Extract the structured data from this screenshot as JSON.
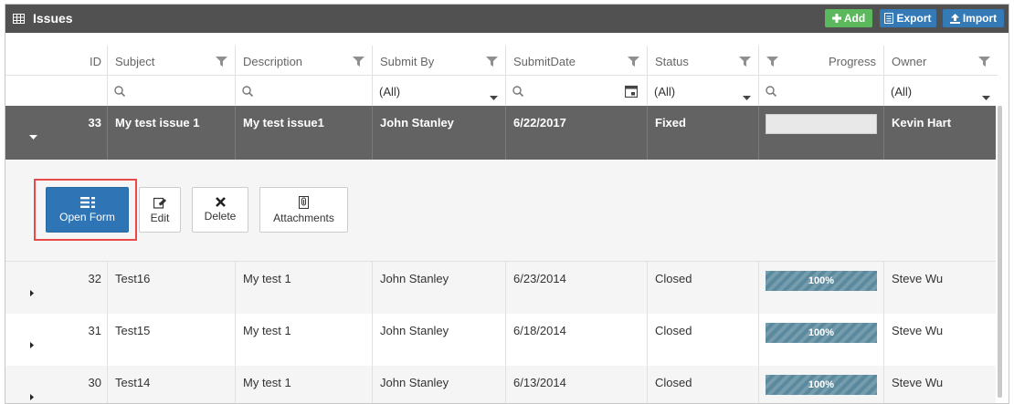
{
  "title": "Issues",
  "toolbar": {
    "add": "Add",
    "export": "Export",
    "import": "Import"
  },
  "columns": {
    "id": "ID",
    "subject": "Subject",
    "description": "Description",
    "submit_by": "Submit By",
    "submit_date": "SubmitDate",
    "status": "Status",
    "progress": "Progress",
    "owner": "Owner"
  },
  "filters": {
    "submit_by": "(All)",
    "status": "(All)",
    "owner": "(All)"
  },
  "selected_row": {
    "id": "33",
    "subject": "My test issue 1",
    "description": "My test issue1",
    "submit_by": "John Stanley",
    "submit_date": "6/22/2017",
    "status": "Fixed",
    "owner": "Kevin Hart"
  },
  "detail_actions": {
    "open_form": "Open Form",
    "edit": "Edit",
    "delete": "Delete",
    "attachments": "Attachments"
  },
  "rows": [
    {
      "id": "32",
      "subject": "Test16",
      "description": "My test 1",
      "submit_by": "John Stanley",
      "submit_date": "6/23/2014",
      "status": "Closed",
      "progress": 100,
      "progress_label": "100%",
      "owner": "Steve Wu"
    },
    {
      "id": "31",
      "subject": "Test15",
      "description": "My test 1",
      "submit_by": "John Stanley",
      "submit_date": "6/18/2014",
      "status": "Closed",
      "progress": 100,
      "progress_label": "100%",
      "owner": "Steve Wu"
    },
    {
      "id": "30",
      "subject": "Test14",
      "description": "My test 1",
      "submit_by": "John Stanley",
      "submit_date": "6/13/2014",
      "status": "Closed",
      "progress": 100,
      "progress_label": "100%",
      "owner": "Steve Wu"
    }
  ],
  "colors": {
    "titlebar": "#515151",
    "selected_row": "#636363",
    "add_button": "#5cb85c",
    "primary_button": "#2f75b5",
    "progress_bar": "#5b8a9e",
    "highlight_box": "#e84a4a"
  },
  "icons": {
    "title": "grid-icon",
    "filter": "funnel-icon",
    "search": "search-icon",
    "calendar": "calendar-icon",
    "expand": "caret-icon"
  }
}
